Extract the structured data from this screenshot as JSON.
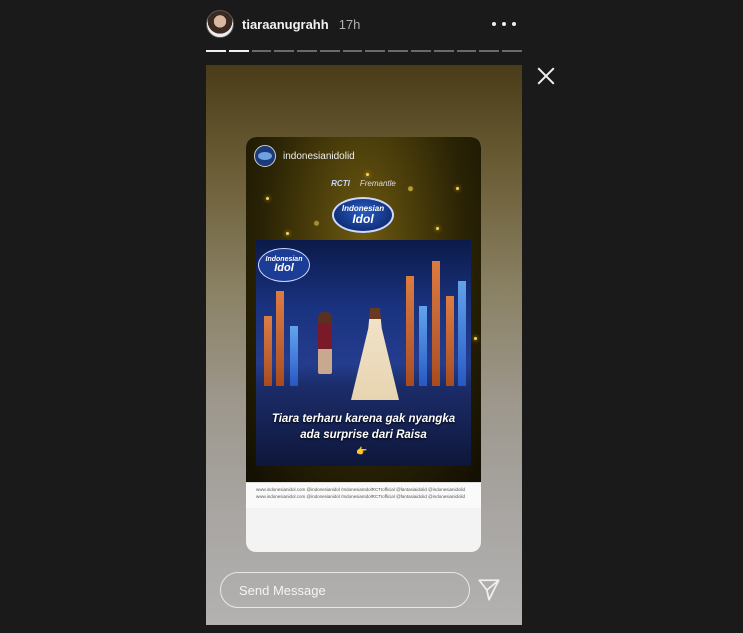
{
  "header": {
    "username": "tiaraanugrahh",
    "time": "17h",
    "progress_total": 14,
    "progress_done": 2
  },
  "story": {
    "reposted_account": "indonesianidolid",
    "brands": [
      "RCTI",
      "Fremantle"
    ],
    "logo_line1": "Indonesian",
    "logo_line2": "Idol",
    "caption_line1": "Tiara terharu karena gak nyangka",
    "caption_line2": "ada surprise dari Raisa",
    "caption_emoji": "👉",
    "footer_text": "www.indonesianidol.com  @indonesianidol  /IndonesianIdolRCTIofficial  @fantasiaidolid  @indonesianidolid"
  },
  "message": {
    "placeholder": "Send Message"
  },
  "icons": {
    "more": "more-horizontal-icon",
    "close": "close-icon",
    "send": "send-icon"
  },
  "colors": {
    "background": "#1a1a1a",
    "text": "#f2f2f2"
  }
}
